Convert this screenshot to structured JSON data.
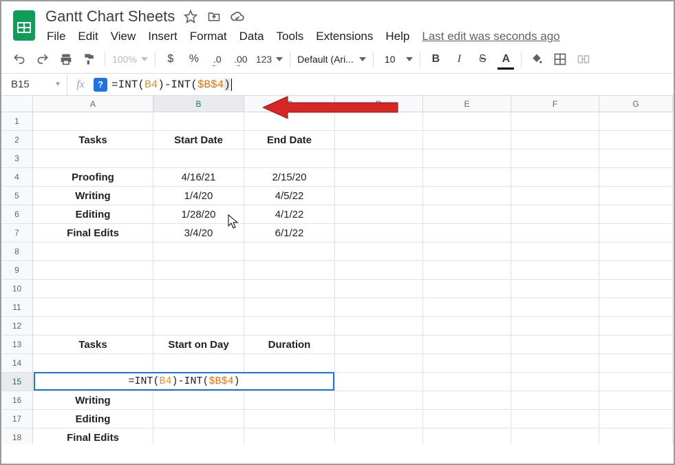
{
  "doc": {
    "title": "Gantt Chart Sheets",
    "last_edit": "Last edit was seconds ago"
  },
  "menu": {
    "file": "File",
    "edit": "Edit",
    "view": "View",
    "insert": "Insert",
    "format": "Format",
    "data": "Data",
    "tools": "Tools",
    "extensions": "Extensions",
    "help": "Help"
  },
  "toolbar": {
    "zoom": "100%",
    "currency": "$",
    "percent": "%",
    "dec_less": ".0",
    "dec_more": ".00",
    "num_fmt": "123",
    "font": "Default (Ari...",
    "font_size": "10",
    "bold": "B",
    "italic": "I",
    "strike": "S",
    "text_color": "A"
  },
  "formula_bar": {
    "cell_ref": "B15",
    "help": "?",
    "prefix": "=INT(",
    "ref1": "B4",
    "mid": ")-INT(",
    "ref2": "$B$4",
    "suffix": ")"
  },
  "columns": [
    "A",
    "B",
    "C",
    "D",
    "E",
    "F",
    "G"
  ],
  "rows": [
    "1",
    "2",
    "3",
    "4",
    "5",
    "6",
    "7",
    "8",
    "9",
    "10",
    "11",
    "12",
    "13",
    "14",
    "15",
    "16",
    "17",
    "18"
  ],
  "cells": {
    "A2": "Tasks",
    "B2": "Start Date",
    "C2": "End Date",
    "A4": "Proofing",
    "B4": "4/16/21",
    "C4": "2/15/20",
    "A5": "Writing",
    "B5": "1/4/20",
    "C5": "4/5/22",
    "A6": "Editing",
    "B6": "1/28/20",
    "C6": "4/1/22",
    "A7": "Final Edits",
    "B7": "3/4/20",
    "C7": "6/1/22",
    "A13": "Tasks",
    "B13": "Start on Day",
    "C13": "Duration",
    "A16": "Writing",
    "A17": "Editing",
    "A18": "Final Edits"
  },
  "bold_cells": [
    "A2",
    "B2",
    "C2",
    "A4",
    "A5",
    "A6",
    "A7",
    "A13",
    "B13",
    "C13",
    "A16",
    "A17",
    "A18"
  ],
  "active_cell": "B15",
  "colors": {
    "brand_green": "#0f9d58",
    "selection_blue": "#1a73e8",
    "ref_orange": "#e69138",
    "arrow_red": "#d72626"
  }
}
